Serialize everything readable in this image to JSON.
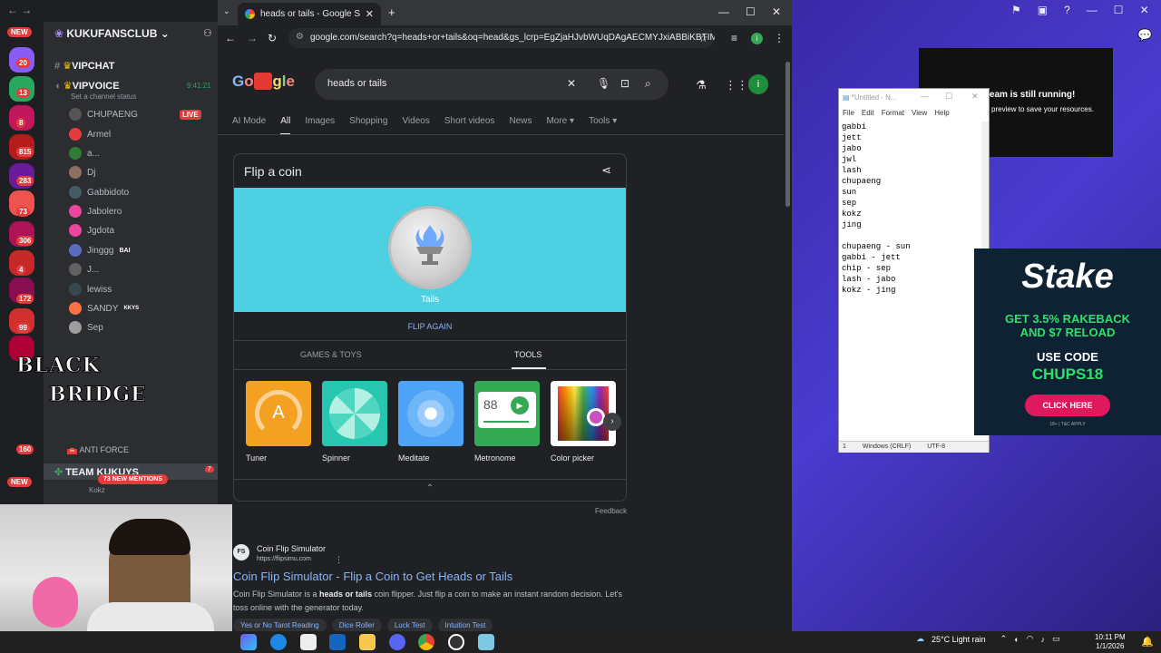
{
  "discord": {
    "server_name": "KUKUFANSCLUB",
    "channels": [
      {
        "name": "VIPCHAT"
      },
      {
        "name": "VIPVOICE",
        "time": "9:41:21"
      }
    ],
    "channel_status": "Set a channel status",
    "members": [
      {
        "name": "CHUPAENG",
        "live": "LIVE"
      },
      {
        "name": "Armel"
      },
      {
        "name": "a..."
      },
      {
        "name": "Dj"
      },
      {
        "name": "Gabbidoto"
      },
      {
        "name": "Jabolero"
      },
      {
        "name": "Jgdota"
      },
      {
        "name": "Jinggg",
        "tag": "BAI"
      },
      {
        "name": "J..."
      },
      {
        "name": "lewiss"
      },
      {
        "name": "SANDY",
        "tag": "KKYS"
      },
      {
        "name": "Sep"
      }
    ],
    "anti_force": "ANTI FORCE",
    "team": "TEAM KUKUYS",
    "team_count": "7",
    "mentions": "73 NEW MENTIONS",
    "kokz": "Kokz",
    "new_badge": "NEW",
    "server_badges": [
      "20",
      "13",
      "8",
      "815",
      "283",
      "73",
      "306",
      "4",
      "172",
      "99",
      "160"
    ]
  },
  "chrome": {
    "tab_title": "heads or tails - Google Search",
    "url": "google.com/search?q=heads+or+tails&oq=head&gs_lcrp=EgZjaHJvbWUqDAgAECMYJxiABBiKBTIM...",
    "profile_initial": "i"
  },
  "google": {
    "query": "heads or tails",
    "tabs": [
      "AI Mode",
      "All",
      "Images",
      "Shopping",
      "Videos",
      "Short videos",
      "News",
      "More",
      "Tools"
    ],
    "coin": {
      "title": "Flip a coin",
      "result": "Tails",
      "flip_again": "FLIP AGAIN",
      "categories": [
        "GAMES & TOYS",
        "TOOLS"
      ],
      "tools": [
        {
          "name": "Tuner",
          "color": "#f4a020"
        },
        {
          "name": "Spinner",
          "color": "#26c6b0"
        },
        {
          "name": "Meditate",
          "color": "#4fa3f7"
        },
        {
          "name": "Metronome",
          "color": "#34a853",
          "value": "88"
        },
        {
          "name": "Color picker",
          "color": "#ffffff"
        }
      ],
      "tuner_letter": "A"
    },
    "feedback": "Feedback",
    "result": {
      "favicon": "FS",
      "site": "Coin Flip Simulator",
      "url": "https://flipsimu.com",
      "title": "Coin Flip Simulator - Flip a Coin to Get Heads or Tails",
      "snippet_pre": "Coin Flip Simulator is a ",
      "snippet_bold": "heads or tails",
      "snippet_post": " coin flipper. Just flip a coin to make an instant random decision. Let's toss online with the generator today.",
      "chips": [
        "Yes or No Tarot Reading",
        "Dice Roller",
        "Luck Test",
        "Intuition Test"
      ]
    }
  },
  "stream_notice": {
    "line1": "ream is still running!",
    "line2": "preview to save your resources."
  },
  "notepad": {
    "title": "*Untitled - N...",
    "menu": [
      "File",
      "Edit",
      "Format",
      "View",
      "Help"
    ],
    "text": "gabbi\njett\njabo\njwl\nlash\nchupaeng\nsun\nsep\nkokz\njing\n\nchupaeng - sun\ngabbi - jett\nchip - sep\nlash - jabo\nkokz - jing",
    "status_line": "1",
    "status_eol": "Windows (CRLF)",
    "status_enc": "UTF-8"
  },
  "stake": {
    "logo": "Stake",
    "line1a": "GET 3.5% RAKEBACK",
    "line1b": "AND $7 RELOAD",
    "line2": "USE CODE",
    "code": "CHUPS18",
    "button": "CLICK HERE",
    "fine": "18+ | T&C APPLY"
  },
  "overlay_logo": {
    "line1": "BLACK",
    "line2": "BRIDGE"
  },
  "taskbar": {
    "weather": "25°C  Light rain",
    "time": "10:11 PM",
    "date": "1/1/2026"
  }
}
